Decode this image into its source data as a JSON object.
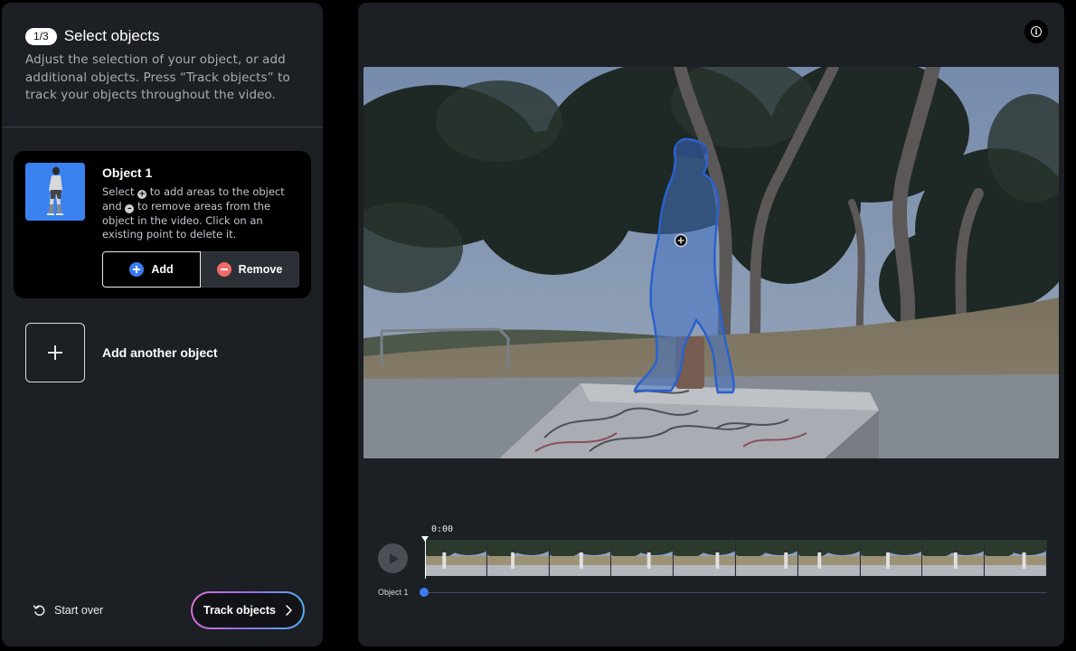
{
  "header": {
    "step": "1/3",
    "title": "Select objects",
    "description": "Adjust the selection of your object, or add additional objects. Press “Track objects” to track your objects throughout the video."
  },
  "object": {
    "name": "Object 1",
    "help_part1": "Select",
    "help_part2": "to add areas to the object and",
    "help_part3": "to remove areas from the object in the video. Click on an existing point to delete it.",
    "add_label": "Add",
    "remove_label": "Remove"
  },
  "add_another": {
    "label": "Add another object"
  },
  "footer": {
    "start_over_label": "Start over",
    "track_label": "Track objects"
  },
  "timeline": {
    "timecode": "0:00",
    "track_name": "Object 1",
    "frame_count": 10
  },
  "colors": {
    "accent_blue": "#3b7cf3",
    "remove_red": "#f06a6a",
    "panel_bg": "#1c1f24"
  },
  "icons": {
    "info": "info-icon",
    "play": "play-icon",
    "start_over": "undo-icon",
    "track": "chevron-right-icon"
  }
}
